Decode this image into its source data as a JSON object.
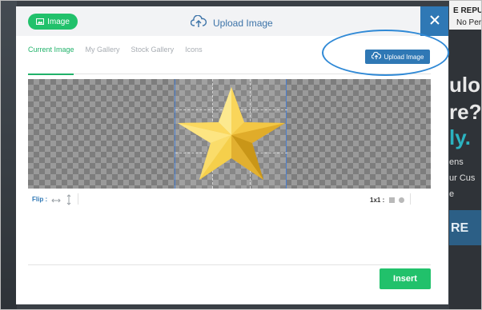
{
  "background": {
    "line1": "E REPUI",
    "line2": "No Pers",
    "heading1": "ulon",
    "heading2": "re?",
    "heading3": "ly.",
    "sub1": "ens",
    "sub2": "ur Cus",
    "sub3": "e",
    "button": "RE"
  },
  "modal": {
    "image_tag": "Image",
    "title": "Upload Image",
    "close_icon": "×",
    "tabs": [
      {
        "label": "Current Image",
        "active": true
      },
      {
        "label": "My Gallery",
        "active": false
      },
      {
        "label": "Stock Gallery",
        "active": false
      },
      {
        "label": "Icons",
        "active": false
      }
    ],
    "upload_button": "Upload Image",
    "flip_label": "Flip :",
    "ratio_label": "1x1 :",
    "insert_button": "Insert"
  },
  "colors": {
    "green": "#21c16b",
    "blue": "#2f78b5",
    "highlight": "#2f89d6",
    "star_gold": "#f2c53d"
  },
  "icons": {
    "image_tag": "image-icon",
    "title": "cloud-upload-icon",
    "close": "close-icon",
    "upload": "cloud-upload-icon",
    "flip_horizontal": "flip-horizontal-icon",
    "flip_vertical": "flip-vertical-icon",
    "ratio_square": "square-shape-icon",
    "ratio_circle": "circle-shape-icon",
    "image": "star-image"
  }
}
